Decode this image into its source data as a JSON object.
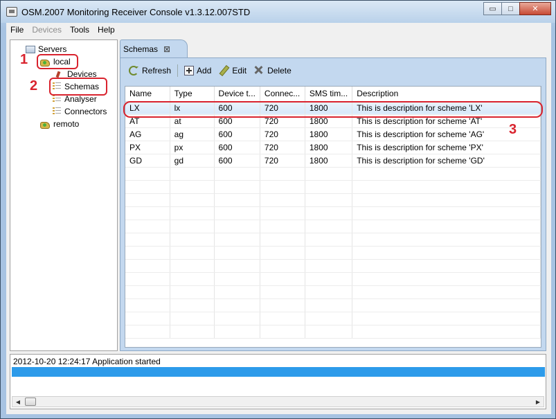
{
  "window": {
    "title": "OSM.2007 Monitoring Receiver Console v1.3.12.007STD",
    "minimize_glyph": "▭",
    "maximize_glyph": "□",
    "close_glyph": "✕"
  },
  "menu": {
    "items": [
      "File",
      "Devices",
      "Tools",
      "Help"
    ],
    "disabled": [
      "Devices"
    ]
  },
  "tree": {
    "root": "Servers",
    "local": "local",
    "devices": "Devices",
    "schemas": "Schemas",
    "analyser": "Analyser",
    "connectors": "Connectors",
    "remoto": "remoto"
  },
  "annotations": {
    "one": "1",
    "two": "2",
    "three": "3",
    "color": "#d9232e"
  },
  "tab": {
    "label": "Schemas",
    "close_glyph": "⊠"
  },
  "toolbar": {
    "refresh": "Refresh",
    "add": "Add",
    "edit": "Edit",
    "delete": "Delete"
  },
  "table": {
    "columns": [
      "Name",
      "Type",
      "Device t...",
      "Connec...",
      "SMS tim...",
      "Description"
    ],
    "rows": [
      [
        "LX",
        "lx",
        "600",
        "720",
        "1800",
        "This is description for scheme 'LX'"
      ],
      [
        "AT",
        "at",
        "600",
        "720",
        "1800",
        "This is description for scheme 'AT'"
      ],
      [
        "AG",
        "ag",
        "600",
        "720",
        "1800",
        "This is description for scheme 'AG'"
      ],
      [
        "PX",
        "px",
        "600",
        "720",
        "1800",
        "This is description for scheme 'PX'"
      ],
      [
        "GD",
        "gd",
        "600",
        "720",
        "1800",
        "This is description for scheme 'GD'"
      ]
    ],
    "selected_row": 0
  },
  "log": {
    "entry": "2012-10-20 12:24:17  Application started",
    "bar_color": "#2d9bea"
  },
  "colors": {
    "tab_bg": "#c3d8ef",
    "selection": "#d7e8fa"
  }
}
